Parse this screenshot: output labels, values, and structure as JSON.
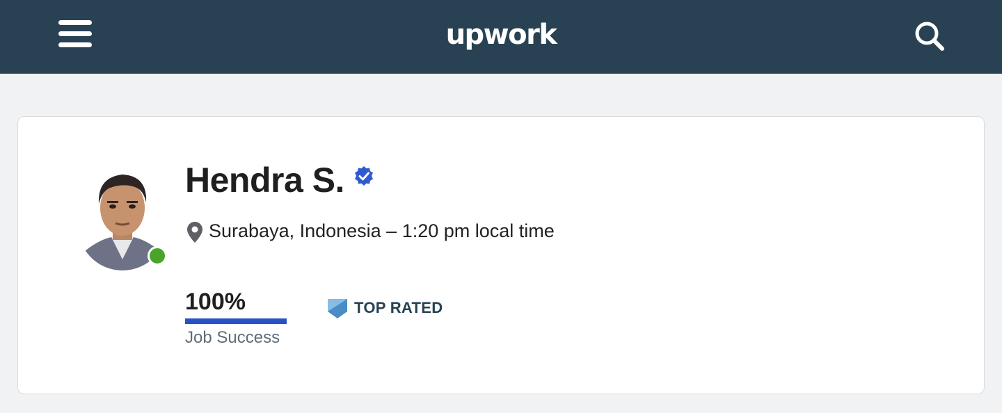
{
  "header": {
    "logo_text": "upwork",
    "menu_icon": "hamburger-menu-icon",
    "search_icon": "search-icon",
    "background_color": "#284253"
  },
  "profile": {
    "name": "Hendra S.",
    "verified_icon": "verified-badge-icon",
    "location": "Surabaya, Indonesia – 1:20 pm local time",
    "location_icon": "location-pin-icon",
    "online_status_color": "#4ba32a",
    "job_success": {
      "value": "100%",
      "fraction": 1.0,
      "label": "Job Success",
      "bar_color": "#2853c4"
    },
    "badge": {
      "label": "TOP RATED",
      "icon": "top-rated-shield-icon"
    }
  }
}
